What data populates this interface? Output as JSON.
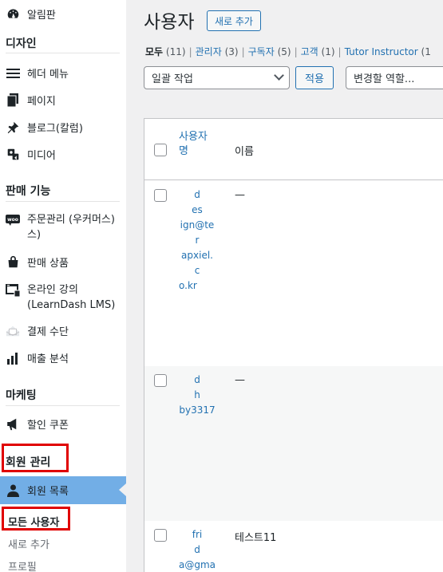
{
  "sidebar": {
    "dashboard": "알림판",
    "design_head": "디자인",
    "menu": [
      {
        "icon": "menu-lines-icon",
        "label": "헤더 메뉴"
      },
      {
        "icon": "pages-icon",
        "label": "페이지"
      },
      {
        "icon": "pin-icon",
        "label": "블로그(칼럼)"
      },
      {
        "icon": "media-icon",
        "label": "미디어"
      }
    ],
    "sales_head": "판매 기능",
    "sales": [
      {
        "icon": "woo-icon",
        "label": "주문관리 (우커머스)",
        "label_line2": "스)"
      },
      {
        "icon": "bag-icon",
        "label": "판매 상품"
      },
      {
        "icon": "course-icon",
        "label": "온라인 강의",
        "label_line2": "(LearnDash LMS)"
      },
      {
        "icon": "payment-icon",
        "label": "결제 수단"
      },
      {
        "icon": "bar-chart-icon",
        "label": "매출 분석"
      }
    ],
    "marketing_head": "마케팅",
    "marketing": [
      {
        "icon": "megaphone-icon",
        "label": "할인 쿠폰"
      }
    ],
    "members_head": "회원 관리",
    "active": "회원 목록",
    "submenu": [
      "모든 사용자",
      "새로 추가",
      "프로필"
    ]
  },
  "main": {
    "title": "사용자",
    "add_new": "새로 추가",
    "filters": [
      {
        "label": "모두",
        "count": "(11)",
        "current": true
      },
      {
        "label": "관리자",
        "count": "(3)"
      },
      {
        "label": "구독자",
        "count": "(5)"
      },
      {
        "label": "고객",
        "count": "(1)"
      },
      {
        "label": "Tutor Instructor",
        "count": "(1"
      }
    ],
    "bulk_select": "일괄 작업",
    "apply": "적용",
    "role_select": "변경할 역할...",
    "table": {
      "col_username": "사용자명",
      "col_name": "이름",
      "rows": [
        {
          "username_lines": [
            "d",
            "es",
            "ign@ter",
            "apxiel.c",
            "o.kr"
          ],
          "name": "—"
        },
        {
          "username_lines": [
            "d",
            "h",
            "by3317"
          ],
          "name": "—"
        },
        {
          "username_lines": [
            "fri",
            "d",
            "a@gmai"
          ],
          "name": "테스트11"
        }
      ]
    }
  }
}
